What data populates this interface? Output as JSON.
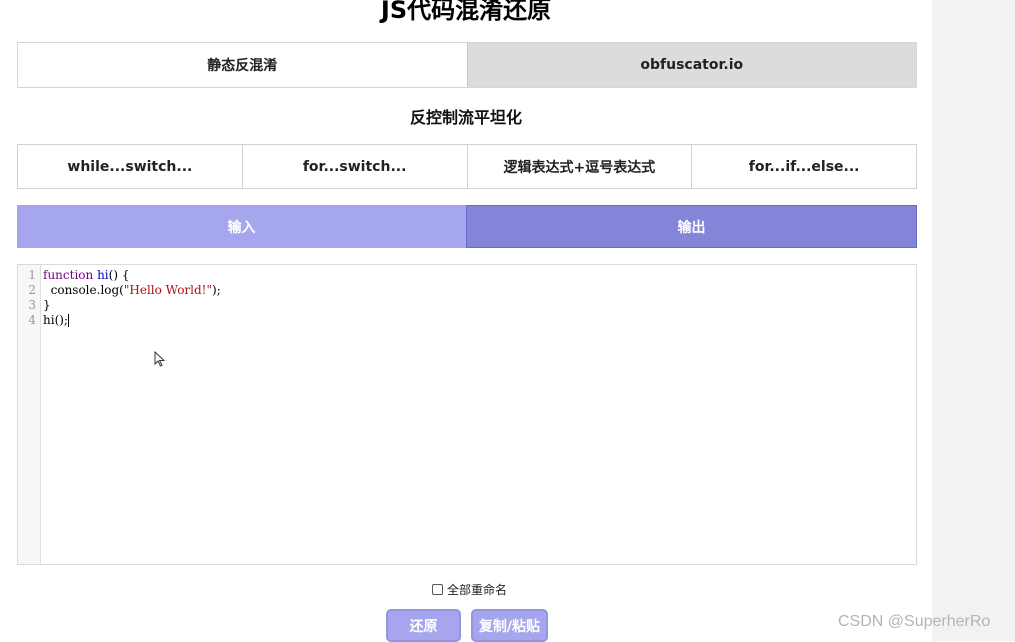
{
  "title": "JS代码混淆还原",
  "mode_tabs": [
    {
      "label": "静态反混淆",
      "active": false
    },
    {
      "label": "obfuscator.io",
      "active": true
    }
  ],
  "section_title": "反控制流平坦化",
  "flat_tabs": [
    {
      "label": "while...switch..."
    },
    {
      "label": "for...switch..."
    },
    {
      "label": "逻辑表达式+逗号表达式"
    },
    {
      "label": "for...if...else..."
    }
  ],
  "io_tabs": {
    "input": "输入",
    "output": "输出"
  },
  "editor": {
    "line_numbers": [
      "1",
      "2",
      "3",
      "4"
    ],
    "lines": [
      {
        "kw": "function",
        "fn": "hi",
        "rest": "() {"
      },
      {
        "pre": "  console.log(",
        "str": "\"Hello World!\"",
        "post": ");"
      },
      {
        "text": "}"
      },
      {
        "text": "hi();"
      }
    ]
  },
  "rename_checkbox": {
    "label": "全部重命名",
    "checked": false
  },
  "buttons": {
    "restore": "还原",
    "copy_paste": "复制/粘贴"
  },
  "watermark": "CSDN @SuperherRo",
  "colors": {
    "accent_light": "#a6a6ee",
    "accent_dark": "#8484d8"
  }
}
